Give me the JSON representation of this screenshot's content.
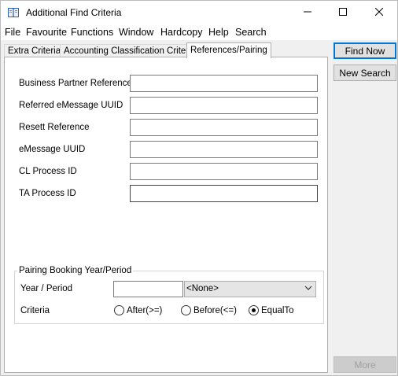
{
  "window": {
    "title": "Additional Find Criteria"
  },
  "menu": [
    "File",
    "Favourite",
    "Functions",
    "Window",
    "Hardcopy",
    "Help",
    "Search"
  ],
  "tabs": [
    {
      "label": "Extra Criteria",
      "active": false
    },
    {
      "label": "Accounting Classification Criteria",
      "active": false
    },
    {
      "label": "References/Pairing",
      "active": true
    }
  ],
  "fields": [
    {
      "label": "Business Partner Reference",
      "value": ""
    },
    {
      "label": "Referred eMessage UUID",
      "value": ""
    },
    {
      "label": "Resett Reference",
      "value": ""
    },
    {
      "label": "eMessage UUID",
      "value": ""
    },
    {
      "label": "CL Process ID",
      "value": ""
    },
    {
      "label": "TA Process ID",
      "value": ""
    }
  ],
  "pairing": {
    "group_title": "Pairing Booking Year/Period",
    "year_period_label": "Year / Period",
    "year_period_value": "",
    "period_selected": "<None>",
    "criteria_label": "Criteria",
    "options": [
      "After(>=)",
      "Before(<=)",
      "EqualTo"
    ],
    "selected": "EqualTo"
  },
  "buttons": {
    "find_now": "Find Now",
    "new_search": "New Search",
    "more": "More"
  },
  "icons": {
    "app": "book-icon",
    "minimize": "minimize-icon",
    "maximize": "maximize-icon",
    "close": "close-icon",
    "dropdown": "chevron-down-icon"
  },
  "colors": {
    "titlebar_bg": "#ffffff",
    "window_bg": "#f0f0f0",
    "default_button_border": "#0078d7"
  }
}
